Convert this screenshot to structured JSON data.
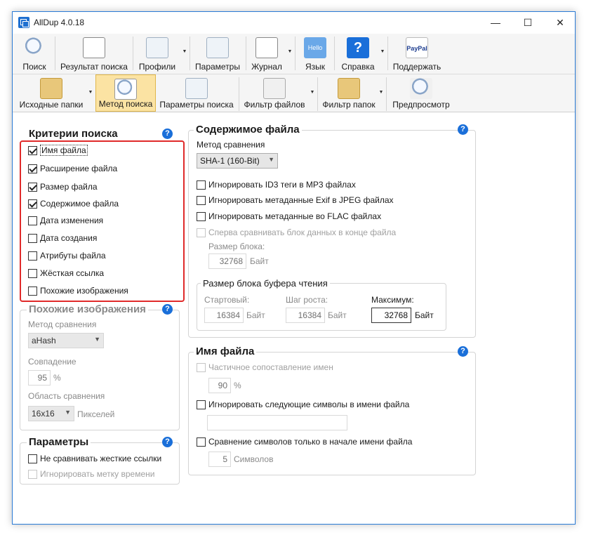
{
  "window": {
    "title": "AllDup 4.0.18",
    "minimize": "—",
    "maximize": "☐",
    "close": "✕"
  },
  "toolbar_main": [
    {
      "label": "Поиск",
      "icon": "search-icon"
    },
    {
      "label": "Результат поиска",
      "icon": "results-icon"
    },
    {
      "label": "Профили",
      "icon": "profiles-icon"
    },
    {
      "label": "Параметры",
      "icon": "settings-icon"
    },
    {
      "label": "Журнал",
      "icon": "log-icon"
    },
    {
      "label": "Язык",
      "icon": "language-icon",
      "text": "Hello"
    },
    {
      "label": "Справка",
      "icon": "help-icon",
      "text": "?"
    },
    {
      "label": "Поддержать",
      "icon": "paypal-icon",
      "text": "PayPal"
    }
  ],
  "toolbar_tabs": [
    {
      "label": "Исходные папки",
      "icon": "folder-icon"
    },
    {
      "label": "Метод поиска",
      "icon": "search-method-icon",
      "active": true
    },
    {
      "label": "Параметры поиска",
      "icon": "search-settings-icon"
    },
    {
      "label": "Фильтр файлов",
      "icon": "file-filter-icon"
    },
    {
      "label": "Фильтр папок",
      "icon": "folder-filter-icon"
    },
    {
      "label": "Предпросмотр",
      "icon": "preview-icon"
    }
  ],
  "criteria": {
    "title": "Критерии поиска",
    "items": [
      {
        "label": "Имя файла",
        "checked": true
      },
      {
        "label": "Расширение файла",
        "checked": true
      },
      {
        "label": "Размер файла",
        "checked": true
      },
      {
        "label": "Содержимое файла",
        "checked": true
      },
      {
        "label": "Дата изменения",
        "checked": false
      },
      {
        "label": "Дата создания",
        "checked": false
      },
      {
        "label": "Атрибуты файла",
        "checked": false
      },
      {
        "label": "Жёсткая ссылка",
        "checked": false
      },
      {
        "label": "Похожие изображения",
        "checked": false
      }
    ]
  },
  "similar_images": {
    "title": "Похожие изображения",
    "method_label": "Метод сравнения",
    "method_value": "aHash",
    "match_label": "Совпадение",
    "match_value": "95",
    "match_unit": "%",
    "area_label": "Область сравнения",
    "area_value": "16x16",
    "area_unit": "Пикселей"
  },
  "params": {
    "title": "Параметры",
    "items": [
      {
        "label": "Не сравнивать жесткие ссылки",
        "checked": false,
        "disabled": false
      },
      {
        "label": "Игнорировать метку времени",
        "checked": false,
        "disabled": true
      }
    ]
  },
  "content": {
    "title": "Содержимое файла",
    "method_label": "Метод сравнения",
    "method_value": "SHA-1 (160-Bit)",
    "options": [
      {
        "label": "Игнорировать ID3 теги в MP3 файлах",
        "checked": false,
        "disabled": false
      },
      {
        "label": "Игнорировать метаданные Exif в JPEG файлах",
        "checked": false,
        "disabled": false
      },
      {
        "label": "Игнорировать метаданные во FLAC файлах",
        "checked": false,
        "disabled": false
      },
      {
        "label": "Сперва сравнивать блок данных в конце файла",
        "checked": false,
        "disabled": true
      }
    ],
    "block_size_label": "Размер блока:",
    "block_size_value": "32768",
    "block_size_unit": "Байт",
    "buffer": {
      "title": "Размер блока буфера чтения",
      "start_label": "Стартовый:",
      "start_value": "16384",
      "start_unit": "Байт",
      "step_label": "Шаг роста:",
      "step_value": "16384",
      "step_unit": "Байт",
      "max_label": "Максимум:",
      "max_value": "32768",
      "max_unit": "Байт"
    }
  },
  "filename": {
    "title": "Имя файла",
    "partial_label": "Частичное сопоставление имен",
    "partial_value": "90",
    "partial_unit": "%",
    "ignore_label": "Игнорировать следующие символы в имени файла",
    "ignore_value": "",
    "compare_start_label": "Сравнение символов только в начале имени файла",
    "chars_value": "5",
    "chars_unit": "Символов"
  },
  "help_glyph": "?",
  "colors": {
    "accent": "#1a6fd9",
    "highlight": "#e02a2a",
    "active_tab": "#fbe3a3"
  }
}
